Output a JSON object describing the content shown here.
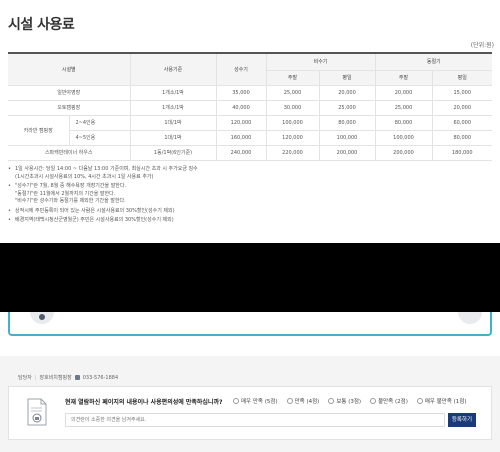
{
  "page": {
    "title": "시설 사용료",
    "unit": "(단위:원)"
  },
  "table": {
    "headers": {
      "facility": "시설별",
      "basis": "사용기준",
      "peak": "성수기",
      "offpeak": "비수기",
      "winter": "동절기",
      "weekend": "주말",
      "weekday": "평일"
    },
    "rows": [
      {
        "name": "일반야영장",
        "sub": "",
        "basis": "1개소/1박",
        "peak": "35,000",
        "off_weekend": "25,000",
        "off_weekday": "20,000",
        "win_weekend": "20,000",
        "win_weekday": "15,000"
      },
      {
        "name": "오토캠핑장",
        "sub": "",
        "basis": "1개소/1박",
        "peak": "40,000",
        "off_weekend": "30,000",
        "off_weekday": "25,000",
        "win_weekend": "25,000",
        "win_weekday": "20,000"
      },
      {
        "name": "카라반 캠핑장",
        "sub": "2~4인용",
        "basis": "1대/1박",
        "peak": "120,000",
        "off_weekend": "100,000",
        "off_weekday": "80,000",
        "win_weekend": "80,000",
        "win_weekday": "60,000"
      },
      {
        "name": "",
        "sub": "4~5인용",
        "basis": "1대/1박",
        "peak": "160,000",
        "off_weekend": "120,000",
        "off_weekday": "100,000",
        "win_weekend": "100,000",
        "win_weekday": "80,000"
      },
      {
        "name": "스파캐빈테이너 하우스",
        "sub": "",
        "basis": "1동/1박(6인기준)",
        "peak": "240,000",
        "off_weekend": "220,000",
        "off_weekday": "200,000",
        "win_weekend": "200,000",
        "win_weekday": "180,000"
      }
    ]
  },
  "notes": [
    [
      "1일 사용시간: 당일 14:00 ~ 다음날 13:00 기준이며, 최실시간 초과 시 추가요금 징수",
      "(1시간초과시 시설사용료의 10%, 4시간 초과시 1일 사용료 추가)"
    ],
    [
      "\"성수기\"란 7월, 8월 중 해수욕장 개장기간을 말한다.",
      "\"동절기\"란 11월에서 2월까지의 기간을 말한다.",
      "\"비수기\"란 성수기와 동절기를 제외한 기간을 말한다."
    ],
    [
      "상적시에 주민등록이 되어 있는 사람은 시설사용료의 30%할인(성수기 제외)"
    ],
    [
      "배경지역(태백시청산군영월군) 주민은 시설사용료의 30%할인(성수기 제외)"
    ]
  ],
  "footer": {
    "contact_label": "담당자",
    "contact_dept": "장호비치캠핑장",
    "contact_phone": "033-576-1884",
    "survey_question": "현재 열람하신 페이지의 내용이나 사용편의성에 만족하십니까?",
    "options": [
      "매우 만족 (5점)",
      "만족 (4점)",
      "보통 (3점)",
      "불만족 (2점)",
      "매우 불만족 (1점)"
    ],
    "input_placeholder": "의견란이 소중한 의견을 남겨주세요.",
    "submit_label": "등록하기"
  },
  "colors": {
    "accent": "#3fb4c8",
    "submit": "#1b3b78",
    "redaction": "#000000"
  }
}
